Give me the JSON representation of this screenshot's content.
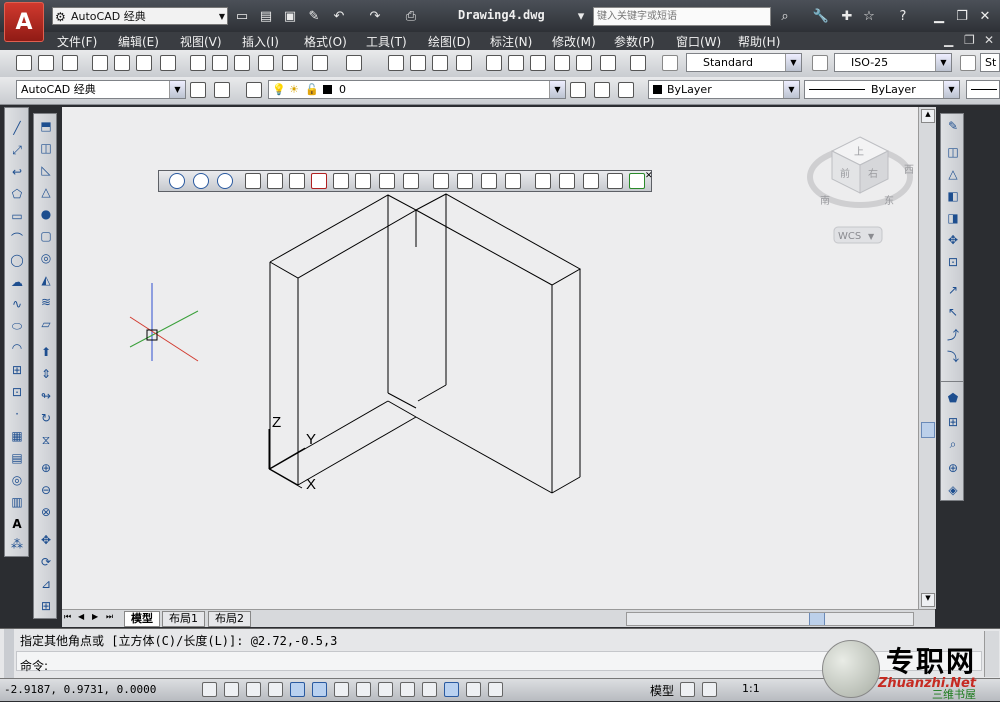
{
  "titlebar": {
    "workspace": "AutoCAD 经典",
    "doc_title": "Drawing4.dwg",
    "search_placeholder": "键入关键字或短语",
    "app_logo": "A"
  },
  "menu": [
    "文件(F)",
    "编辑(E)",
    "视图(V)",
    "插入(I)",
    "格式(O)",
    "工具(T)",
    "绘图(D)",
    "标注(N)",
    "修改(M)",
    "参数(P)",
    "窗口(W)",
    "帮助(H)"
  ],
  "styles": {
    "text_style": "Standard",
    "dim_style": "ISO-25",
    "extra": "St"
  },
  "layers": {
    "workspace_combo": "AutoCAD 经典",
    "layer_name": "0",
    "color": "ByLayer",
    "linetype": "ByLayer"
  },
  "viewcube": {
    "top": "上",
    "front": "前",
    "right": "右",
    "south": "南",
    "east": "东",
    "west": "西",
    "wcs": "WCS"
  },
  "ucs": {
    "z": "Z",
    "y": "Y",
    "x": "X"
  },
  "tabs": [
    "模型",
    "布局1",
    "布局2"
  ],
  "command": {
    "history": "指定其他角点或 [立方体(C)/长度(L)]: @2.72,-0.5,3",
    "prompt": "命令:"
  },
  "status": {
    "coords": "-2.9187, 0.9731, 0.0000",
    "model": "模型",
    "scale": "1:1"
  },
  "watermark": {
    "site_cn": "专职网",
    "site_en": "Zhuanzhi.Net",
    "sub": "三维书屋"
  },
  "colors": {
    "accent_red": "#c62a22",
    "canvas": "#ededee",
    "ucs_green": "#3aa03a",
    "ucs_red": "#d23a2f",
    "ucs_blue": "#3050d0"
  }
}
